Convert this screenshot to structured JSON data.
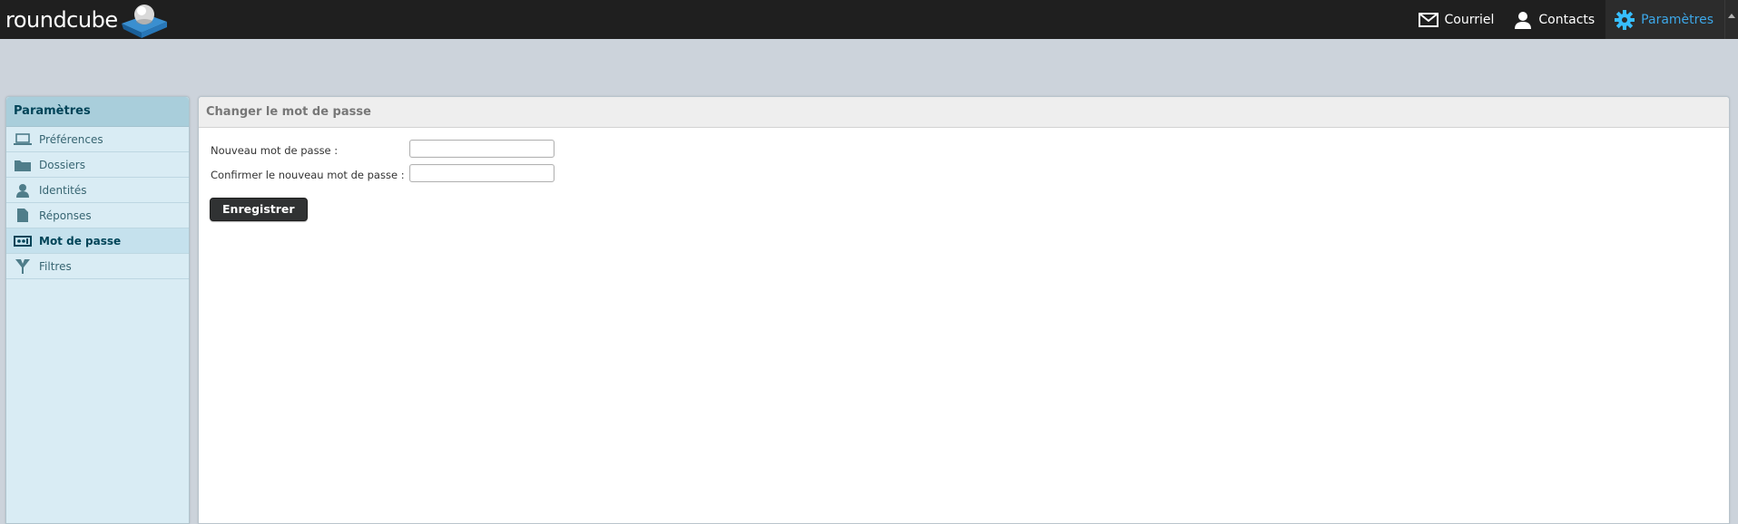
{
  "app": {
    "logo_text": "roundcube"
  },
  "topnav": {
    "items": [
      {
        "label": "Courriel",
        "icon": "envelope-icon"
      },
      {
        "label": "Contacts",
        "icon": "person-icon"
      },
      {
        "label": "Paramètres",
        "icon": "gear-icon",
        "active": true
      }
    ]
  },
  "sidebar": {
    "title": "Paramètres",
    "items": [
      {
        "label": "Préférences",
        "icon": "laptop-icon"
      },
      {
        "label": "Dossiers",
        "icon": "folder-icon"
      },
      {
        "label": "Identités",
        "icon": "person-icon"
      },
      {
        "label": "Réponses",
        "icon": "document-icon"
      },
      {
        "label": "Mot de passe",
        "icon": "password-icon",
        "selected": true
      },
      {
        "label": "Filtres",
        "icon": "filter-icon"
      }
    ]
  },
  "main": {
    "title": "Changer le mot de passe",
    "fields": [
      {
        "label": "Nouveau mot de passe :",
        "value": ""
      },
      {
        "label": "Confirmer le nouveau mot de passe :",
        "value": ""
      }
    ],
    "save_label": "Enregistrer"
  },
  "colors": {
    "topbar": "#1f1f1f",
    "accent": "#37beff",
    "sidebar": "#d9ecf4",
    "button": "#303233"
  }
}
